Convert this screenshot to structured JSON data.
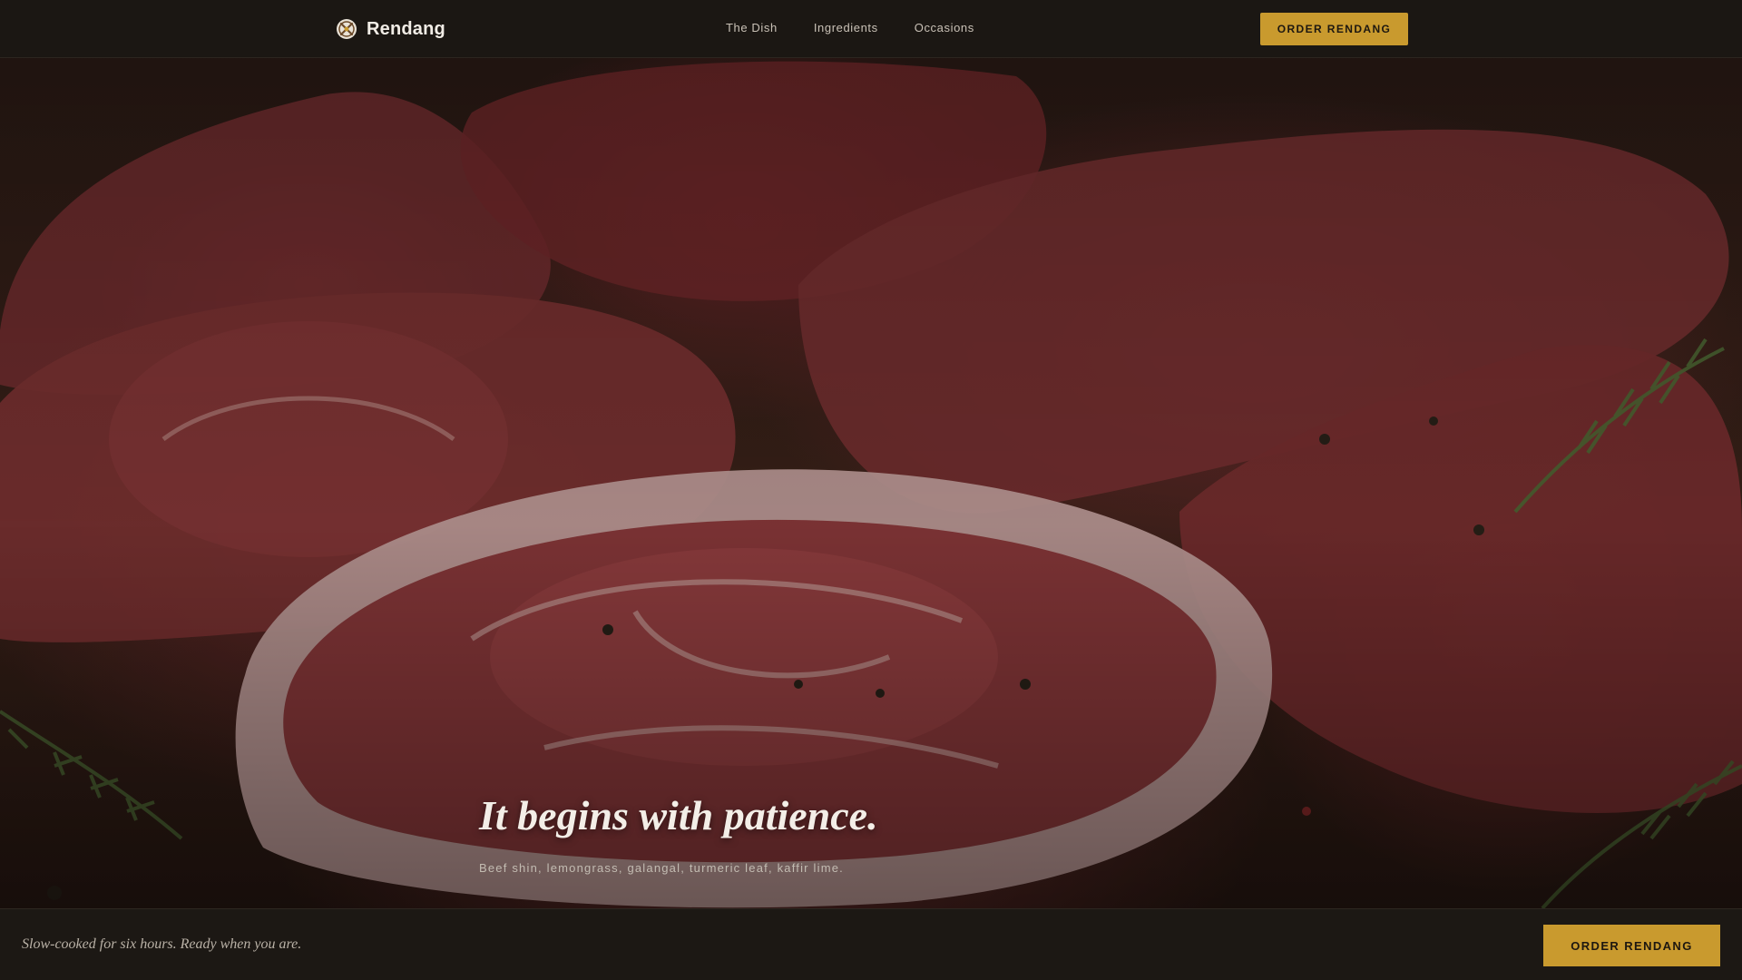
{
  "brand": {
    "name": "Rendang",
    "icon": "rendang-logo-icon"
  },
  "nav": {
    "items": [
      {
        "label": "The Dish"
      },
      {
        "label": "Ingredients"
      },
      {
        "label": "Occasions"
      }
    ],
    "cta_label": "ORDER RENDANG"
  },
  "hero": {
    "headline": "It begins with patience.",
    "subline": "Beef shin, lemongrass, galangal, turmeric leaf, kaffir lime.",
    "image": "raw-beef-cuts-photo"
  },
  "bottom_bar": {
    "text": "Slow-cooked for six hours. Ready when you are.",
    "cta_label": "ORDER RENDANG"
  },
  "colors": {
    "accent": "#c99a2e",
    "bar_background": "#1b1713",
    "text_primary": "#f3eee7",
    "text_muted": "#c3bcb2"
  }
}
